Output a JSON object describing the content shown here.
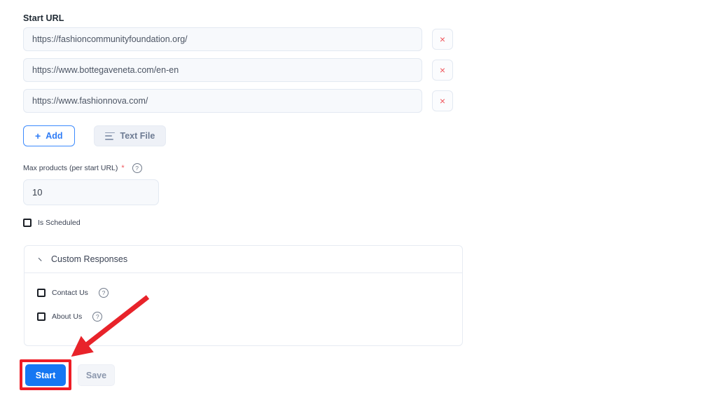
{
  "form": {
    "start_url_label": "Start URL",
    "urls": [
      {
        "value": "https://fashioncommunityfoundation.org/",
        "remove_label": "×"
      },
      {
        "value": "https://www.bottegaveneta.com/en-en",
        "remove_label": "×"
      },
      {
        "value": "https://www.fashionnova.com/",
        "remove_label": "×"
      }
    ],
    "url_placeholder": "https://",
    "add_button": {
      "icon": "plus-icon",
      "label": "Add"
    },
    "text_file_button": {
      "icon": "lines-icon",
      "label": "Text File"
    },
    "max_products": {
      "label": "Max products (per start URL)",
      "required_mark": "*",
      "help_icon": "question-circle-icon",
      "help_glyph": "?",
      "value": "10",
      "placeholder": "10"
    },
    "is_scheduled": {
      "label": "Is Scheduled",
      "checked": false
    },
    "custom_responses": {
      "title": "Custom Responses",
      "collapse_icon": "chevron-up-icon",
      "expanded": true,
      "items": [
        {
          "label": "Contact Us",
          "help_glyph": "?",
          "checked": false
        },
        {
          "label": "About Us",
          "help_glyph": "?",
          "checked": false
        }
      ]
    },
    "footer": {
      "start_label": "Start",
      "save_label": "Save"
    }
  },
  "annotations": {
    "highlight_color": "#ee1c25",
    "arrow_color": "#e8232a",
    "target": "start-button"
  },
  "colors": {
    "primary": "#1677f2",
    "danger": "#f0555c",
    "input_bg": "#f7f9fc",
    "border": "#e3e9f2"
  }
}
